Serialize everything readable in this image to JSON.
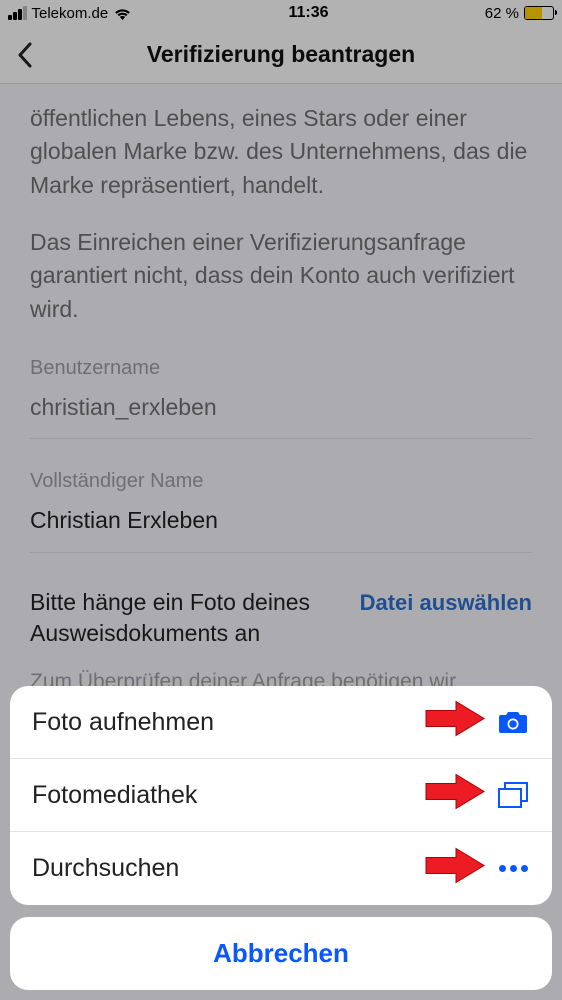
{
  "status": {
    "carrier": "Telekom.de",
    "time": "11:36",
    "battery_pct": "62 %",
    "battery_level": 62
  },
  "nav": {
    "title": "Verifizierung beantragen"
  },
  "content": {
    "desc1": "öffentlichen Lebens, eines Stars oder einer globalen Marke bzw. des Unternehmens, das die Marke repräsentiert, handelt.",
    "desc2": "Das Einreichen einer Verifizierungsanfrage garantiert nicht, dass dein Konto auch verifiziert wird.",
    "username_label": "Benutzername",
    "username_value": "christian_erxleben",
    "fullname_label": "Vollständiger Name",
    "fullname_value": "Christian Erxleben",
    "attach_label": "Bitte hänge ein Foto deines Ausweisdokuments an",
    "choose_file": "Datei auswählen",
    "review_note": "Zum Überprüfen deiner Anfrage benötigen wir"
  },
  "sheet": {
    "take_photo": "Foto aufnehmen",
    "photo_library": "Fotomediathek",
    "browse": "Durchsuchen",
    "cancel": "Abbrechen"
  }
}
